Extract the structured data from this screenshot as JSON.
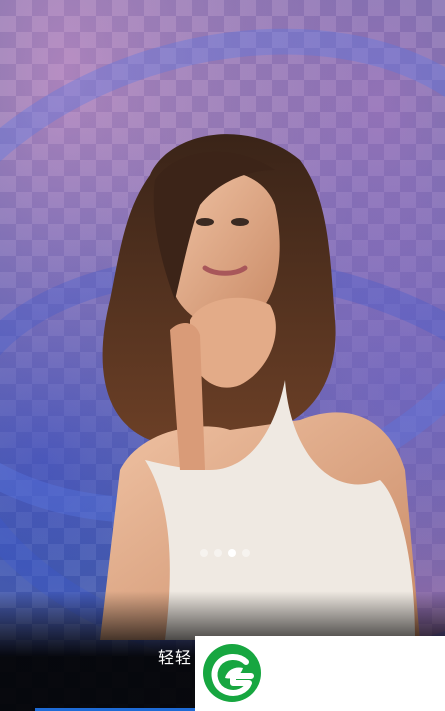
{
  "pager": {
    "count": 4,
    "active_index": 2
  },
  "onboarding": {
    "caption": "轻轻"
  },
  "brand": {
    "logo_icon": "leaf-g-logo-icon",
    "logo_color": "#17a640"
  },
  "colors": {
    "accent": "#1e6bd6",
    "checker_base": "#5d6aa0"
  }
}
